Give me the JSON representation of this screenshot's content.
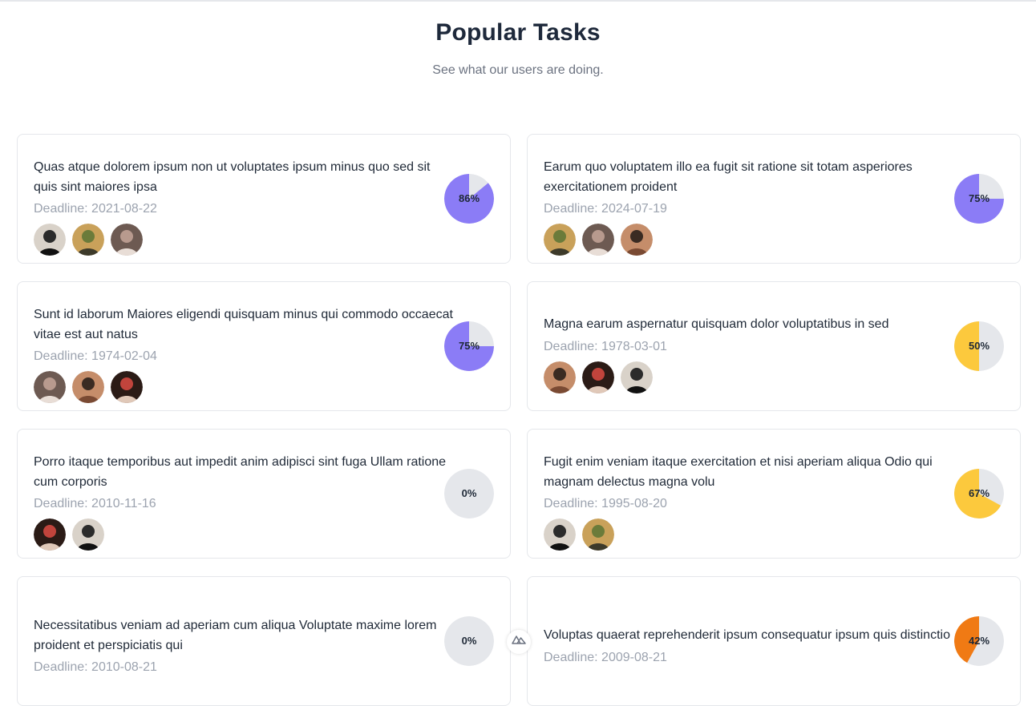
{
  "header": {
    "title": "Popular Tasks",
    "subtitle": "See what our users are doing."
  },
  "colors": {
    "purple": "#8b7cf6",
    "yellow": "#fcc93d",
    "orange": "#f07a14",
    "track": "#e5e7eb"
  },
  "tasks": [
    {
      "title": "Quas atque dolorem ipsum non ut voluptates ipsum minus quo sed sit quis sint maiores ipsa",
      "deadline": "Deadline: 2021-08-22",
      "progress_label": "86%",
      "progress": 86,
      "color": "#8b7cf6",
      "avatars": [
        "avatar-1",
        "avatar-2",
        "avatar-3"
      ]
    },
    {
      "title": "Earum quo voluptatem illo ea fugit sit ratione sit totam asperiores exercitationem proident",
      "deadline": "Deadline: 2024-07-19",
      "progress_label": "75%",
      "progress": 75,
      "color": "#8b7cf6",
      "avatars": [
        "avatar-1",
        "avatar-2",
        "avatar-3"
      ]
    },
    {
      "title": "Sunt id laborum Maiores eligendi quisquam minus qui commodo occaecat vitae est aut natus",
      "deadline": "Deadline: 1974-02-04",
      "progress_label": "75%",
      "progress": 75,
      "color": "#8b7cf6",
      "avatars": [
        "avatar-1",
        "avatar-2",
        "avatar-3"
      ]
    },
    {
      "title": "Magna earum aspernatur quisquam dolor voluptatibus in sed",
      "deadline": "Deadline: 1978-03-01",
      "progress_label": "50%",
      "progress": 50,
      "color": "#fcc93d",
      "avatars": [
        "avatar-1",
        "avatar-2",
        "avatar-3"
      ]
    },
    {
      "title": "Porro itaque temporibus aut impedit anim adipisci sint fuga Ullam ratione cum corporis",
      "deadline": "Deadline: 2010-11-16",
      "progress_label": "0%",
      "progress": 0,
      "color": "#8b7cf6",
      "avatars": [
        "avatar-1",
        "avatar-2"
      ]
    },
    {
      "title": "Fugit enim veniam itaque exercitation et nisi aperiam aliqua Odio qui magnam delectus magna volu",
      "deadline": "Deadline: 1995-08-20",
      "progress_label": "67%",
      "progress": 67,
      "color": "#fcc93d",
      "avatars": [
        "avatar-1",
        "avatar-2"
      ]
    },
    {
      "title": "Necessitatibus veniam ad aperiam cum aliqua Voluptate maxime lorem proident et perspiciatis qui",
      "deadline": "Deadline: 2010-08-21",
      "progress_label": "0%",
      "progress": 0,
      "color": "#8b7cf6",
      "avatars": []
    },
    {
      "title": "Voluptas quaerat reprehenderit ipsum consequatur ipsum quis distinctio",
      "deadline": "Deadline: 2009-08-21",
      "progress_label": "42%",
      "progress": 42,
      "color": "#f07a14",
      "avatars": []
    }
  ],
  "badge": {
    "icon": "nuxt-logo-icon"
  }
}
